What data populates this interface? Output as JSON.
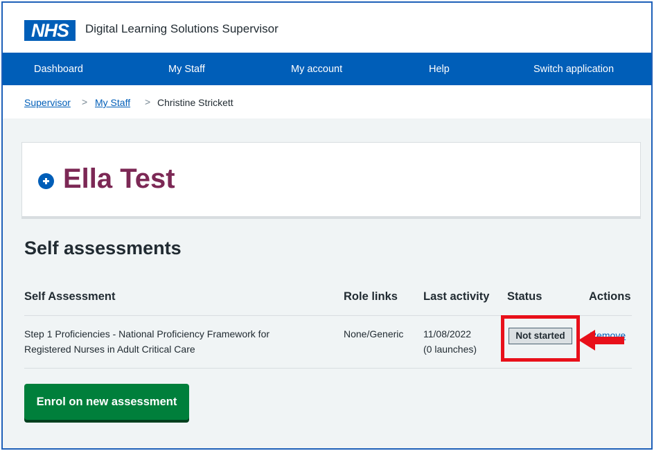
{
  "header": {
    "logo_text": "NHS",
    "app_title": "Digital Learning Solutions Supervisor"
  },
  "nav": {
    "items": [
      {
        "label": "Dashboard"
      },
      {
        "label": "My Staff"
      },
      {
        "label": "My account"
      },
      {
        "label": "Help"
      },
      {
        "label": "Switch application"
      }
    ]
  },
  "breadcrumb": {
    "items": [
      {
        "label": "Supervisor"
      },
      {
        "label": "My Staff"
      },
      {
        "label": "Christine Strickett"
      }
    ],
    "separator": ">"
  },
  "staff_card": {
    "name": "Ella Test",
    "icon": "plus-circle-icon"
  },
  "self_assessments": {
    "title": "Self assessments",
    "columns": [
      "Self Assessment",
      "Role links",
      "Last activity",
      "Status",
      "Actions"
    ],
    "rows": [
      {
        "name_line1": "Step 1 Proficiencies - National Proficiency Framework for",
        "name_line2": "Registered Nurses in Adult Critical Care",
        "role_links": "None/Generic",
        "last_activity_date": "11/08/2022",
        "last_activity_launches": "(0 launches)",
        "status": "Not started",
        "action": "Remove"
      }
    ],
    "enrol_button": "Enrol on new assessment"
  },
  "colors": {
    "nhs_blue": "#005eb8",
    "name_color": "#7c2855",
    "button_green": "#007f3b",
    "annotation_red": "#e8101a"
  }
}
